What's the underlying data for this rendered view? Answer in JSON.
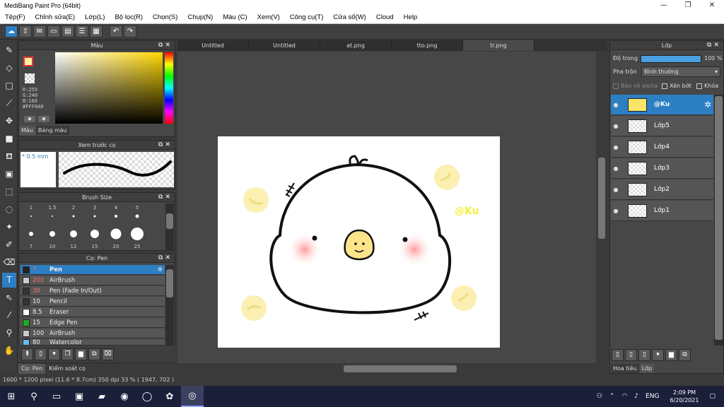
{
  "window": {
    "title": "MediBang Paint Pro (64bit)",
    "min": "—",
    "max": "❐",
    "close": "✕"
  },
  "menu": [
    "Tệp(F)",
    "Chỉnh sửa(E)",
    "Lớp(L)",
    "Bộ lọc(R)",
    "Chọn(S)",
    "Chụp(N)",
    "Màu (C)",
    "Xem(V)",
    "Công cụ(T)",
    "Cửa sổ(W)",
    "Cloud",
    "Help"
  ],
  "color_panel": {
    "title": "Màu",
    "rgb": "R:255\nG:240\nB:160\n#FFF0A0",
    "tabs": [
      "Màu",
      "Bảng màu"
    ],
    "fg": "#fff0a0"
  },
  "preview_panel": {
    "title": "Xem trước cọ",
    "size": "* 0.5 mm"
  },
  "brushsize_panel": {
    "title": "Brush Size",
    "sizes": [
      "1",
      "1.5",
      "2",
      "3",
      "4",
      "5",
      "7",
      "10",
      "12",
      "15",
      "20",
      "25"
    ]
  },
  "brush_panel": {
    "title": "Cọ: Pen",
    "rows": [
      {
        "size": "7",
        "name": "Pen",
        "color": "#222222",
        "sel": true
      },
      {
        "size": "200",
        "name": "AirBrush",
        "color": "#cccccc"
      },
      {
        "size": "30",
        "name": "Pen (Fade In/Out)",
        "color": "#333333"
      },
      {
        "size": "10",
        "name": "Pencil",
        "color": "#333333"
      },
      {
        "size": "8.5",
        "name": "Eraser",
        "color": "#ffffff"
      },
      {
        "size": "15",
        "name": "Edge Pen",
        "color": "#22aa22"
      },
      {
        "size": "100",
        "name": "AirBrush",
        "color": "#cccccc"
      },
      {
        "size": "80",
        "name": "Watercolor",
        "color": "#66bbee"
      }
    ],
    "tabs": [
      "Cọ: Pen",
      "Kiểm soát cọ"
    ]
  },
  "doc_tabs": [
    "Untitled",
    "Untitled",
    "at.png",
    "tto.png",
    "tr.png"
  ],
  "layer_panel": {
    "title": "Lớp",
    "opacity_label": "Độ trong",
    "opacity": "100 %",
    "blend_label": "Pha trộn",
    "blend": "Bình thường",
    "protect_alpha": "Bảo vệ alpha",
    "clip": "Xén bớt",
    "lock": "Khóa",
    "layers": [
      "@Ku",
      "Lớp5",
      "Lớp4",
      "Lớp3",
      "Lớp2",
      "Lớp1"
    ],
    "tabs": [
      "Hoa tiêu",
      "Lớp"
    ]
  },
  "canvas": {
    "signature": "@Ku"
  },
  "status": "1600 * 1200 pixel   (11.6 * 8.7cm)   350 dpi   33 %   ( 1947, 702 )",
  "taskbar": {
    "lang": "ENG",
    "time": "2:09 PM",
    "date": "6/20/2021"
  }
}
